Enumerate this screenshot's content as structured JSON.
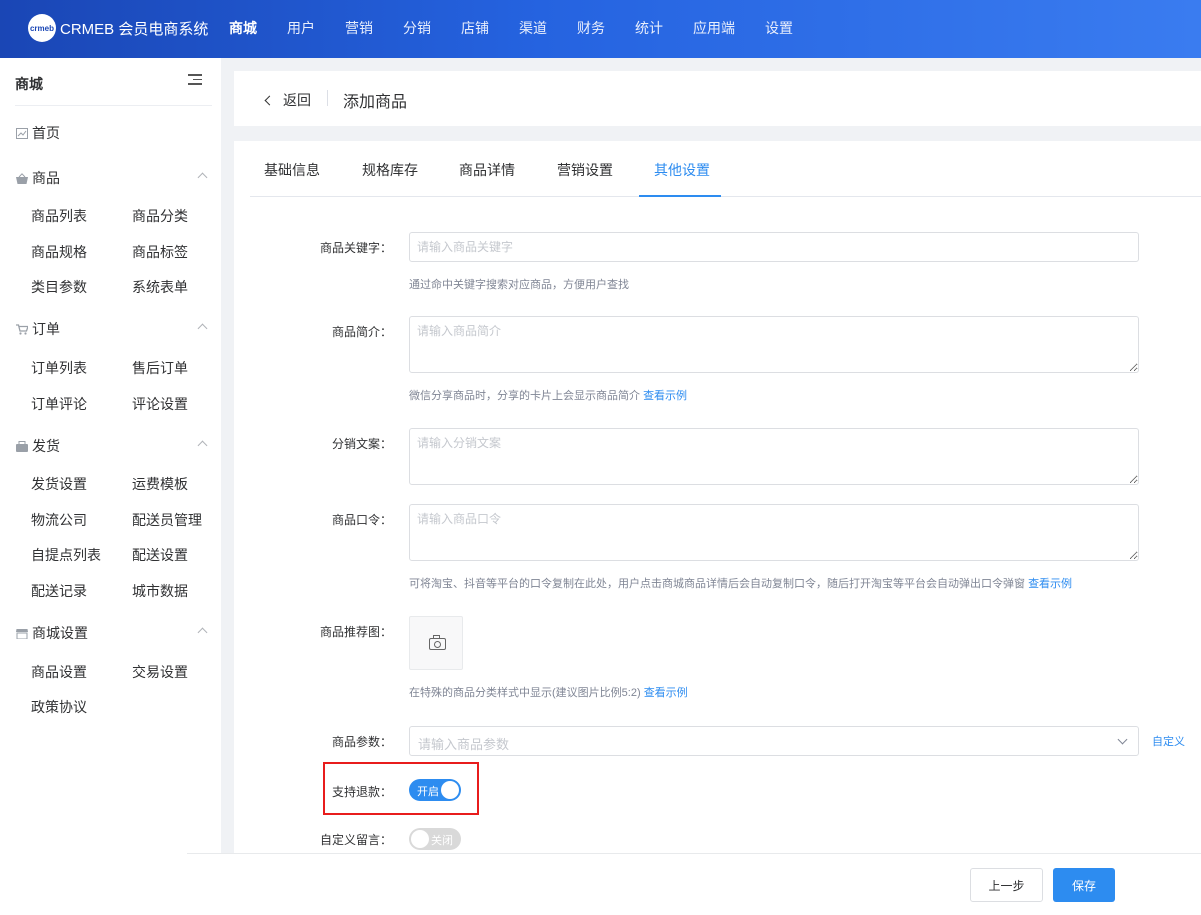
{
  "app": {
    "logo_badge": "crmeb",
    "logo_text": "CRMEB 会员电商系统"
  },
  "nav": [
    "商城",
    "用户",
    "营销",
    "分销",
    "店铺",
    "渠道",
    "财务",
    "统计",
    "应用端",
    "设置"
  ],
  "sidebar": {
    "title": "商城",
    "home": "首页",
    "groups": [
      {
        "label": "商品",
        "items": [
          "商品列表",
          "商品分类",
          "商品规格",
          "商品标签",
          "类目参数",
          "系统表单"
        ]
      },
      {
        "label": "订单",
        "items": [
          "订单列表",
          "售后订单",
          "订单评论",
          "评论设置"
        ]
      },
      {
        "label": "发货",
        "items": [
          "发货设置",
          "运费模板",
          "物流公司",
          "配送员管理",
          "自提点列表",
          "配送设置",
          "配送记录",
          "城市数据"
        ]
      },
      {
        "label": "商城设置",
        "items": [
          "商品设置",
          "交易设置",
          "政策协议"
        ]
      }
    ]
  },
  "header": {
    "back": "返回",
    "title": "添加商品"
  },
  "tabs": [
    "基础信息",
    "规格库存",
    "商品详情",
    "营销设置",
    "其他设置"
  ],
  "active_tab": "其他设置",
  "form": {
    "keywords": {
      "label": "商品关键字：",
      "placeholder": "请输入商品关键字",
      "value": "",
      "tip": "通过命中关键字搜索对应商品，方便用户查找"
    },
    "intro": {
      "label": "商品简介：",
      "placeholder": "请输入商品简介",
      "value": "",
      "tip": "微信分享商品时，分享的卡片上会显示商品简介",
      "tip_link": "查看示例"
    },
    "distribution_copy": {
      "label": "分销文案：",
      "placeholder": "请输入分销文案",
      "value": ""
    },
    "password": {
      "label": "商品口令：",
      "placeholder": "请输入商品口令",
      "value": "",
      "tip": "可将淘宝、抖音等平台的口令复制在此处，用户点击商城商品详情后会自动复制口令，随后打开淘宝等平台会自动弹出口令弹窗",
      "tip_link": "查看示例"
    },
    "recommend_image": {
      "label": "商品推荐图：",
      "tip": "在特殊的商品分类样式中显示(建议图片比例5:2)",
      "tip_link": "查看示例"
    },
    "params": {
      "label": "商品参数：",
      "placeholder": "请输入商品参数",
      "custom": "自定义"
    },
    "refund": {
      "label": "支持退款：",
      "state_text": "开启",
      "enabled": true
    },
    "custom_message": {
      "label": "自定义留言：",
      "state_text": "关闭",
      "enabled": false
    }
  },
  "footer": {
    "prev": "上一步",
    "save": "保存"
  },
  "colors": {
    "primary": "#2d8cf0",
    "nav_gradient_start": "#1a46b5",
    "highlight": "#e81c1c"
  }
}
